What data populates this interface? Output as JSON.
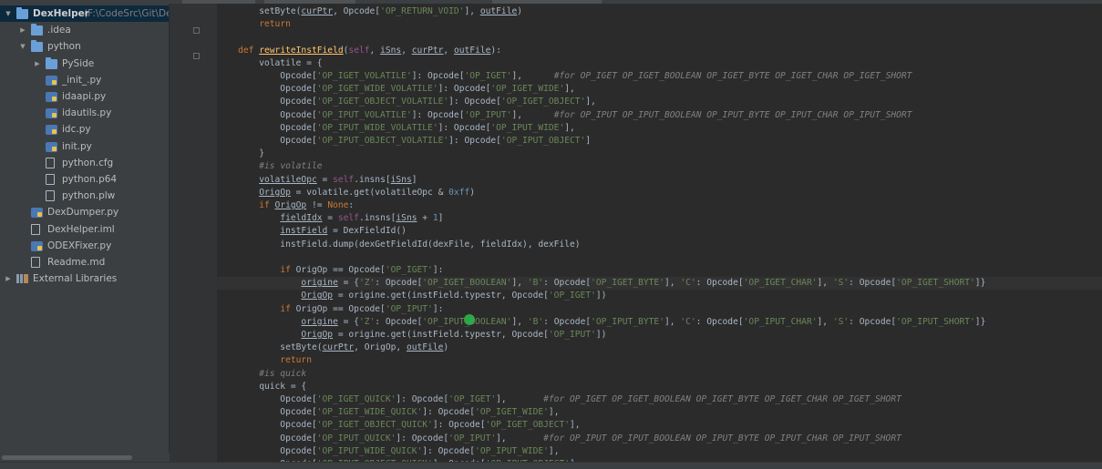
{
  "project": {
    "name": "DexHelper",
    "path": "(F:\\CodeSrc\\Git\\De",
    "tree": [
      {
        "label": "DexHelper",
        "sub": "(F:\\CodeSrc\\Git\\De",
        "icon": "project-folder-icon",
        "arrow": "▼",
        "level": 0,
        "selected": true
      },
      {
        "label": ".idea",
        "icon": "folder-icon",
        "arrow": "▶",
        "level": 1
      },
      {
        "label": "python",
        "icon": "folder-icon",
        "arrow": "▼",
        "level": 1
      },
      {
        "label": "PySide",
        "icon": "folder-icon",
        "arrow": "▶",
        "level": 2
      },
      {
        "label": "_init_.py",
        "icon": "python-file-icon",
        "arrow": "",
        "level": 2
      },
      {
        "label": "idaapi.py",
        "icon": "python-file-icon",
        "arrow": "",
        "level": 2
      },
      {
        "label": "idautils.py",
        "icon": "python-file-icon",
        "arrow": "",
        "level": 2
      },
      {
        "label": "idc.py",
        "icon": "python-file-icon",
        "arrow": "",
        "level": 2
      },
      {
        "label": "init.py",
        "icon": "python-file-icon",
        "arrow": "",
        "level": 2
      },
      {
        "label": "python.cfg",
        "icon": "text-file-icon",
        "arrow": "",
        "level": 2
      },
      {
        "label": "python.p64",
        "icon": "text-file-icon",
        "arrow": "",
        "level": 2
      },
      {
        "label": "python.plw",
        "icon": "text-file-icon",
        "arrow": "",
        "level": 2
      },
      {
        "label": "DexDumper.py",
        "icon": "python-file-icon",
        "arrow": "",
        "level": 1
      },
      {
        "label": "DexHelper.iml",
        "icon": "text-file-icon",
        "arrow": "",
        "level": 1
      },
      {
        "label": "ODEXFixer.py",
        "icon": "python-file-icon",
        "arrow": "",
        "level": 1
      },
      {
        "label": "Readme.md",
        "icon": "text-file-icon",
        "arrow": "",
        "level": 1
      },
      {
        "label": "External Libraries",
        "icon": "libraries-icon",
        "arrow": "▶",
        "level": 0
      }
    ]
  },
  "code": [
    [
      [
        "        setByte(",
        ""
      ],
      [
        "curPtr",
        "u"
      ],
      [
        ", Opcode[",
        ""
      ],
      [
        "'OP_RETURN_VOID'",
        "str"
      ],
      [
        "], ",
        ""
      ],
      [
        "outFile",
        "u"
      ],
      [
        ")",
        ""
      ]
    ],
    [
      [
        "        ",
        ""
      ],
      [
        "return",
        "kw"
      ]
    ],
    [
      [
        "",
        ""
      ]
    ],
    [
      [
        "    ",
        ""
      ],
      [
        "def ",
        "kw"
      ],
      [
        "rewriteInstField",
        "fn"
      ],
      [
        "(",
        ""
      ],
      [
        "self",
        "self"
      ],
      [
        ", ",
        ""
      ],
      [
        "iSns",
        "param"
      ],
      [
        ", ",
        ""
      ],
      [
        "curPtr",
        "param"
      ],
      [
        ", ",
        ""
      ],
      [
        "outFile",
        "param"
      ],
      [
        "):",
        ""
      ]
    ],
    [
      [
        "        volatile = {",
        ""
      ]
    ],
    [
      [
        "            Opcode[",
        ""
      ],
      [
        "'OP_IGET_VOLATILE'",
        "str"
      ],
      [
        "]: Opcode[",
        ""
      ],
      [
        "'OP_IGET'",
        "str"
      ],
      [
        "],      ",
        ""
      ],
      [
        "#for OP_IGET OP_IGET_BOOLEAN OP_IGET_BYTE OP_IGET_CHAR OP_IGET_SHORT",
        "cmt"
      ]
    ],
    [
      [
        "            Opcode[",
        ""
      ],
      [
        "'OP_IGET_WIDE_VOLATILE'",
        "str"
      ],
      [
        "]: Opcode[",
        ""
      ],
      [
        "'OP_IGET_WIDE'",
        "str"
      ],
      [
        "],",
        ""
      ]
    ],
    [
      [
        "            Opcode[",
        ""
      ],
      [
        "'OP_IGET_OBJECT_VOLATILE'",
        "str"
      ],
      [
        "]: Opcode[",
        ""
      ],
      [
        "'OP_IGET_OBJECT'",
        "str"
      ],
      [
        "],",
        ""
      ]
    ],
    [
      [
        "            Opcode[",
        ""
      ],
      [
        "'OP_IPUT_VOLATILE'",
        "str"
      ],
      [
        "]: Opcode[",
        ""
      ],
      [
        "'OP_IPUT'",
        "str"
      ],
      [
        "],      ",
        ""
      ],
      [
        "#for OP_IPUT OP_IPUT_BOOLEAN OP_IPUT_BYTE OP_IPUT_CHAR OP_IPUT_SHORT",
        "cmt"
      ]
    ],
    [
      [
        "            Opcode[",
        ""
      ],
      [
        "'OP_IPUT_WIDE_VOLATILE'",
        "str"
      ],
      [
        "]: Opcode[",
        ""
      ],
      [
        "'OP_IPUT_WIDE'",
        "str"
      ],
      [
        "],",
        ""
      ]
    ],
    [
      [
        "            Opcode[",
        ""
      ],
      [
        "'OP_IPUT_OBJECT_VOLATILE'",
        "str"
      ],
      [
        "]: Opcode[",
        ""
      ],
      [
        "'OP_IPUT_OBJECT'",
        "str"
      ],
      [
        "]",
        ""
      ]
    ],
    [
      [
        "        }",
        ""
      ]
    ],
    [
      [
        "        ",
        ""
      ],
      [
        "#is volatile",
        "cmt"
      ]
    ],
    [
      [
        "        ",
        ""
      ],
      [
        "volatileOpc",
        "u"
      ],
      [
        " = ",
        ""
      ],
      [
        "self",
        "self"
      ],
      [
        ".insns[",
        ""
      ],
      [
        "iSns",
        "u"
      ],
      [
        "]",
        ""
      ]
    ],
    [
      [
        "        ",
        ""
      ],
      [
        "OrigOp",
        "u"
      ],
      [
        " = volatile.get(volatileOpc & ",
        ""
      ],
      [
        "0xff",
        "num"
      ],
      [
        ")",
        ""
      ]
    ],
    [
      [
        "        ",
        ""
      ],
      [
        "if ",
        "kw"
      ],
      [
        "OrigOp",
        "u"
      ],
      [
        " != ",
        ""
      ],
      [
        "None",
        "kw"
      ],
      [
        ":",
        ""
      ]
    ],
    [
      [
        "            ",
        ""
      ],
      [
        "fieldIdx",
        "u"
      ],
      [
        " = ",
        ""
      ],
      [
        "self",
        "self"
      ],
      [
        ".insns[",
        ""
      ],
      [
        "iSns",
        "u"
      ],
      [
        " + ",
        ""
      ],
      [
        "1",
        "num"
      ],
      [
        "]",
        ""
      ]
    ],
    [
      [
        "            ",
        ""
      ],
      [
        "instField",
        "u"
      ],
      [
        " = DexFieldId()",
        ""
      ]
    ],
    [
      [
        "            instField.dump(dexGetFieldId(dexFile, fieldIdx), dexFile)",
        ""
      ]
    ],
    [
      [
        "",
        ""
      ]
    ],
    [
      [
        "            ",
        ""
      ],
      [
        "if ",
        "kw"
      ],
      [
        "OrigOp == Opcode[",
        ""
      ],
      [
        "'OP_IGET'",
        "str"
      ],
      [
        "]:",
        ""
      ]
    ],
    [
      [
        "                ",
        ""
      ],
      [
        "origine",
        "u"
      ],
      [
        " = {",
        ""
      ],
      [
        "'Z'",
        "str"
      ],
      [
        ": Opcode[",
        ""
      ],
      [
        "'OP_IGET_BOOLEAN'",
        "str"
      ],
      [
        "], ",
        ""
      ],
      [
        "'B'",
        "str"
      ],
      [
        ": Opcode[",
        ""
      ],
      [
        "'OP_IGET_BYTE'",
        "str"
      ],
      [
        "], ",
        ""
      ],
      [
        "'C'",
        "str"
      ],
      [
        ": Opcode[",
        ""
      ],
      [
        "'OP_IGET_CHAR'",
        "str"
      ],
      [
        "], ",
        ""
      ],
      [
        "'S'",
        "str"
      ],
      [
        ": Opcode[",
        ""
      ],
      [
        "'OP_IGET_SHORT'",
        "str"
      ],
      [
        "]}",
        ""
      ]
    ],
    [
      [
        "                ",
        ""
      ],
      [
        "OrigOp",
        "u"
      ],
      [
        " = origine.get(instField.typestr, Opcode[",
        ""
      ],
      [
        "'OP_IGET'",
        "str"
      ],
      [
        "])",
        ""
      ]
    ],
    [
      [
        "            ",
        ""
      ],
      [
        "if ",
        "kw"
      ],
      [
        "OrigOp == Opcode[",
        ""
      ],
      [
        "'OP_IPUT'",
        "str"
      ],
      [
        "]:",
        ""
      ]
    ],
    [
      [
        "                ",
        ""
      ],
      [
        "origine",
        "u"
      ],
      [
        " = {",
        ""
      ],
      [
        "'Z'",
        "str"
      ],
      [
        ": Opcode[",
        ""
      ],
      [
        "'OP_IPUT_BOOLEAN'",
        "str"
      ],
      [
        "], ",
        ""
      ],
      [
        "'B'",
        "str"
      ],
      [
        ": Opcode[",
        ""
      ],
      [
        "'OP_IPUT_BYTE'",
        "str"
      ],
      [
        "], ",
        ""
      ],
      [
        "'C'",
        "str"
      ],
      [
        ": Opcode[",
        ""
      ],
      [
        "'OP_IPUT_CHAR'",
        "str"
      ],
      [
        "], ",
        ""
      ],
      [
        "'S'",
        "str"
      ],
      [
        ": Opcode[",
        ""
      ],
      [
        "'OP_IPUT_SHORT'",
        "str"
      ],
      [
        "]}",
        ""
      ]
    ],
    [
      [
        "                ",
        ""
      ],
      [
        "OrigOp",
        "u"
      ],
      [
        " = origine.get(instField.typestr, Opcode[",
        ""
      ],
      [
        "'OP_IPUT'",
        "str"
      ],
      [
        "])",
        ""
      ]
    ],
    [
      [
        "            setByte(",
        ""
      ],
      [
        "curPtr",
        "u"
      ],
      [
        ", OrigOp, ",
        ""
      ],
      [
        "outFile",
        "u"
      ],
      [
        ")",
        ""
      ]
    ],
    [
      [
        "            ",
        ""
      ],
      [
        "return",
        "kw"
      ]
    ],
    [
      [
        "        ",
        ""
      ],
      [
        "#is quick",
        "cmt"
      ]
    ],
    [
      [
        "        quick = {",
        ""
      ]
    ],
    [
      [
        "            Opcode[",
        ""
      ],
      [
        "'OP_IGET_QUICK'",
        "str"
      ],
      [
        "]: Opcode[",
        ""
      ],
      [
        "'OP_IGET'",
        "str"
      ],
      [
        "],       ",
        ""
      ],
      [
        "#for OP_IGET OP_IGET_BOOLEAN OP_IGET_BYTE OP_IGET_CHAR OP_IGET_SHORT",
        "cmt"
      ]
    ],
    [
      [
        "            Opcode[",
        ""
      ],
      [
        "'OP_IGET_WIDE_QUICK'",
        "str"
      ],
      [
        "]: Opcode[",
        ""
      ],
      [
        "'OP_IGET_WIDE'",
        "str"
      ],
      [
        "],",
        ""
      ]
    ],
    [
      [
        "            Opcode[",
        ""
      ],
      [
        "'OP_IGET_OBJECT_QUICK'",
        "str"
      ],
      [
        "]: Opcode[",
        ""
      ],
      [
        "'OP_IGET_OBJECT'",
        "str"
      ],
      [
        "],",
        ""
      ]
    ],
    [
      [
        "            Opcode[",
        ""
      ],
      [
        "'OP_IPUT_QUICK'",
        "str"
      ],
      [
        "]: Opcode[",
        ""
      ],
      [
        "'OP_IPUT'",
        "str"
      ],
      [
        "],       ",
        ""
      ],
      [
        "#for OP_IPUT OP_IPUT_BOOLEAN OP_IPUT_BYTE OP_IPUT_CHAR OP_IPUT_SHORT",
        "cmt"
      ]
    ],
    [
      [
        "            Opcode[",
        ""
      ],
      [
        "'OP_IPUT_WIDE_QUICK'",
        "str"
      ],
      [
        "]: Opcode[",
        ""
      ],
      [
        "'OP_IPUT_WIDE'",
        "str"
      ],
      [
        "],",
        ""
      ]
    ],
    [
      [
        "            Opcode[",
        ""
      ],
      [
        "'OP_IPUT_OBJECT_QUICK'",
        "str"
      ],
      [
        "]: Opcode[",
        ""
      ],
      [
        "'OP_IPUT_OBJECT'",
        "str"
      ],
      [
        "]",
        ""
      ]
    ]
  ],
  "colors": {
    "background": "#2b2b2b",
    "sidebar": "#3c3f41",
    "keyword": "#cc7832",
    "function": "#ffc66d",
    "string": "#6a8759",
    "comment": "#808080",
    "number": "#6897bb",
    "self": "#94558d",
    "text": "#a9b7c6",
    "cursor_marker": "#2fb34a"
  }
}
